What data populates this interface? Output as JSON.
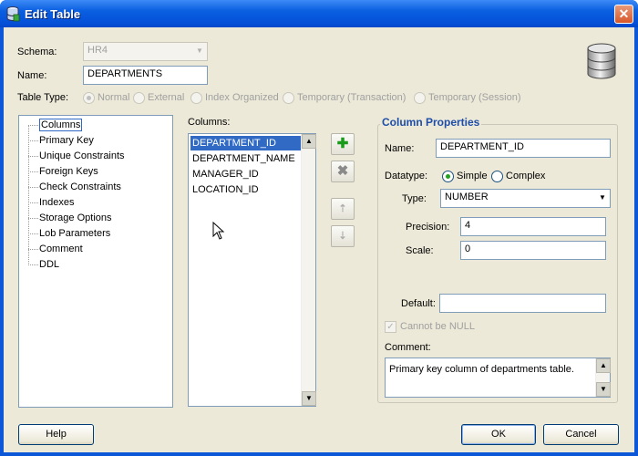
{
  "window": {
    "title": "Edit Table",
    "close_glyph": "✕"
  },
  "form": {
    "schema_label": "Schema:",
    "schema_value": "HR4",
    "name_label": "Name:",
    "name_value": "DEPARTMENTS",
    "table_type_label": "Table Type:",
    "table_types": [
      "Normal",
      "External",
      "Index Organized",
      "Temporary (Transaction)",
      "Temporary (Session)"
    ],
    "selected_table_type": "Normal"
  },
  "tree": {
    "items": [
      "Columns",
      "Primary Key",
      "Unique Constraints",
      "Foreign Keys",
      "Check Constraints",
      "Indexes",
      "Storage Options",
      "Lob Parameters",
      "Comment",
      "DDL"
    ],
    "selected": "Columns"
  },
  "columns_list": {
    "label": "Columns:",
    "items": [
      "DEPARTMENT_ID",
      "DEPARTMENT_NAME",
      "MANAGER_ID",
      "LOCATION_ID"
    ],
    "selected": "DEPARTMENT_ID"
  },
  "tools": {
    "add_glyph": "✚",
    "remove_glyph": "✖",
    "up_glyph": "⇡",
    "down_glyph": "⇣"
  },
  "column_properties": {
    "title": "Column Properties",
    "name_label": "Name:",
    "name_value": "DEPARTMENT_ID",
    "datatype_label": "Datatype:",
    "datatype_options": [
      "Simple",
      "Complex"
    ],
    "type_label": "Type:",
    "type_value": "NUMBER",
    "precision_label": "Precision:",
    "precision_value": "4",
    "scale_label": "Scale:",
    "scale_value": "0",
    "default_label": "Default:",
    "default_value": "",
    "not_null_label": "Cannot be NULL",
    "comment_label": "Comment:",
    "comment_value": "Primary key column of departments table."
  },
  "buttons": {
    "help": "Help",
    "ok": "OK",
    "cancel": "Cancel"
  },
  "colors": {
    "titlebar": "#0450d8",
    "selection": "#316ac5",
    "dialog_bg": "#ece9d8",
    "group_title": "#1f4ea8"
  }
}
